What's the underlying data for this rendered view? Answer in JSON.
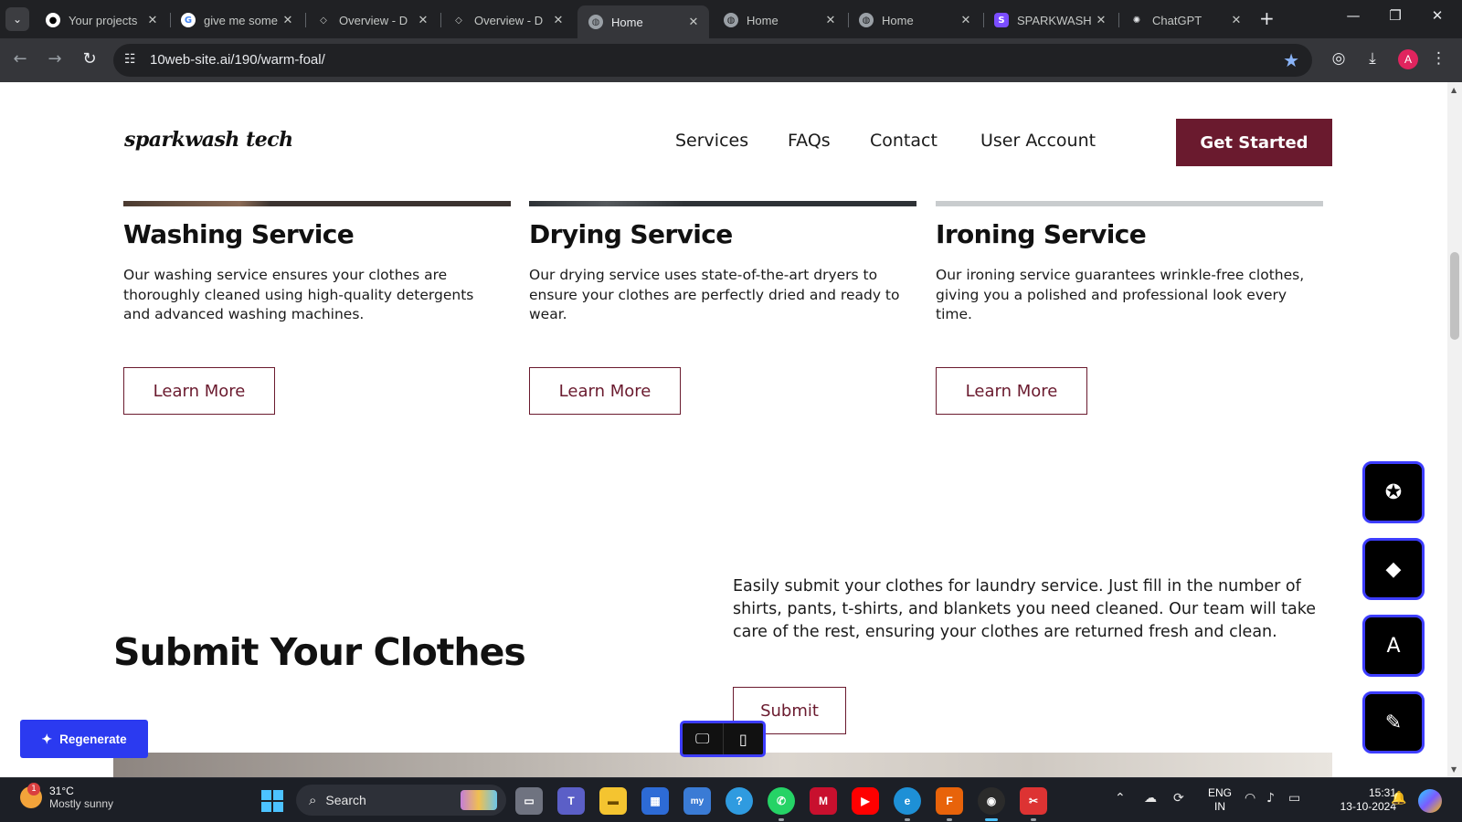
{
  "browser": {
    "tabs": [
      {
        "title": "Your projects",
        "favicon": "github-icon"
      },
      {
        "title": "give me some",
        "favicon": "google-icon"
      },
      {
        "title": "Overview - D",
        "favicon": "diamond-icon"
      },
      {
        "title": "Overview - D",
        "favicon": "diamond-icon"
      },
      {
        "title": "Home",
        "favicon": "globe-icon",
        "active": true
      },
      {
        "title": "Home",
        "favicon": "globe-icon"
      },
      {
        "title": "Home",
        "favicon": "globe-icon"
      },
      {
        "title": "SPARKWASH",
        "favicon": "sparkwash-icon"
      },
      {
        "title": "ChatGPT",
        "favicon": "chatgpt-icon"
      }
    ],
    "url": "10web-site.ai/190/warm-foal/",
    "profile_initial": "A",
    "accent_color": "#8ab4f8"
  },
  "site": {
    "logo": "sparkwash tech",
    "nav": [
      "Services",
      "FAQs",
      "Contact",
      "User Account"
    ],
    "cta": "Get Started",
    "brand_color": "#6a1a2e",
    "services": [
      {
        "title": "Washing Service",
        "desc": "Our washing service ensures your clothes are thoroughly cleaned using high-quality detergents and advanced washing machines.",
        "button": "Learn More"
      },
      {
        "title": "Drying Service",
        "desc": "Our drying service uses state-of-the-art dryers to ensure your clothes are perfectly dried and ready to wear.",
        "button": "Learn More"
      },
      {
        "title": "Ironing Service",
        "desc": "Our ironing service guarantees wrinkle-free clothes, giving you a polished and professional look every time.",
        "button": "Learn More"
      }
    ],
    "submit": {
      "title": "Submit Your Clothes",
      "desc": "Easily submit your clothes for laundry service. Just fill in the number of shirts, pants, t-shirts, and blankets you need cleaned. Our team will take care of the rest, ensuring your clothes are returned fresh and clean.",
      "button": "Submit"
    }
  },
  "editor": {
    "regenerate": "Regenerate",
    "device_modes": [
      "desktop-icon",
      "mobile-icon"
    ],
    "side_tools": [
      "chat-star-icon",
      "diamond-icon",
      "font-style-icon",
      "pen-icon"
    ],
    "accent_color": "#3d3dff"
  },
  "taskbar": {
    "weather": {
      "temp": "31°C",
      "desc": "Mostly sunny",
      "badge": "1"
    },
    "search": "Search",
    "language": {
      "line1": "ENG",
      "line2": "IN"
    },
    "time": "15:31",
    "date": "13-10-2024"
  }
}
